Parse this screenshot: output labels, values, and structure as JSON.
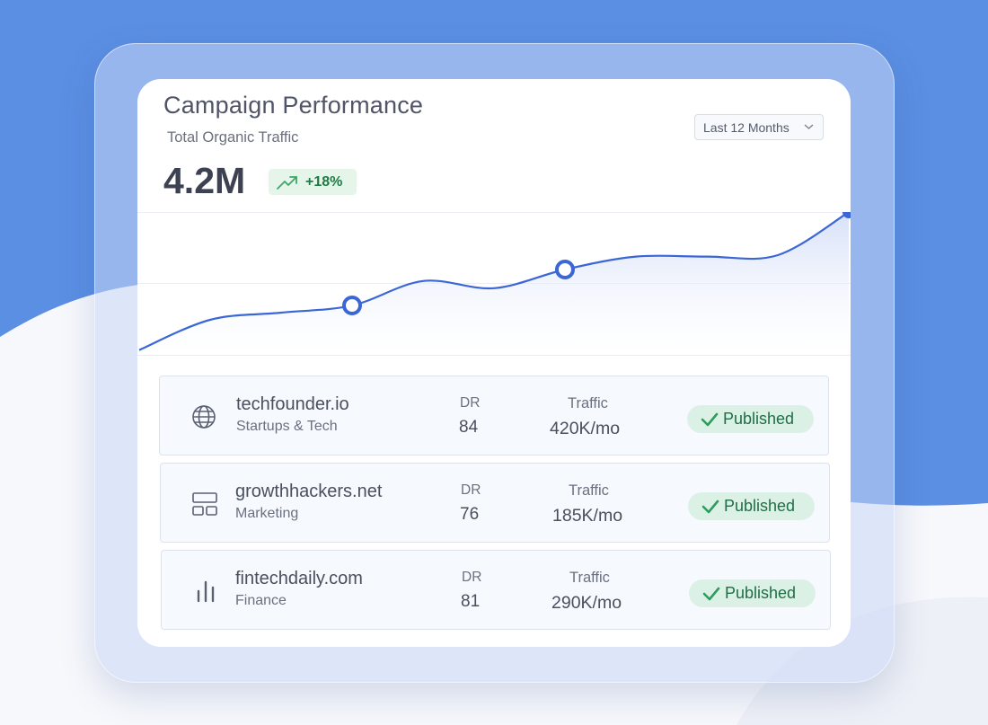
{
  "card": {
    "title": "Campaign Performance",
    "subtitle": "Total Organic Traffic",
    "total_value": "4.2M",
    "growth": "+18%",
    "range_selector": "Last 12 Months"
  },
  "colors": {
    "background": "#5b8fe3",
    "line": "#3b66d6",
    "published_bg": "#dcf1e5",
    "published_text": "#1f6e45",
    "growth_text": "#1f7a45"
  },
  "chart_data": {
    "type": "area",
    "series": [
      {
        "values": [
          0.04,
          0.25,
          0.3,
          0.35,
          0.52,
          0.47,
          0.6,
          0.69,
          0.69,
          0.7,
          1.0
        ]
      }
    ],
    "highlighted_points": [
      3,
      6,
      10
    ],
    "grid": true
  },
  "sites": [
    {
      "name": "techfounder.io",
      "category": "Startups & Tech",
      "dr_label": "DR",
      "dr": "84",
      "traffic_label": "Traffic",
      "traffic": "420K/mo",
      "status": "Published",
      "icon": "globe-icon"
    },
    {
      "name": "growthhackers.net",
      "category": "Marketing",
      "dr_label": "DR",
      "dr": "76",
      "traffic_label": "Traffic",
      "traffic": "185K/mo",
      "status": "Published",
      "icon": "layout-icon"
    },
    {
      "name": "fintechdaily.com",
      "category": "Finance",
      "dr_label": "DR",
      "dr": "81",
      "traffic_label": "Traffic",
      "traffic": "290K/mo",
      "status": "Published",
      "icon": "bar-chart-icon"
    }
  ]
}
